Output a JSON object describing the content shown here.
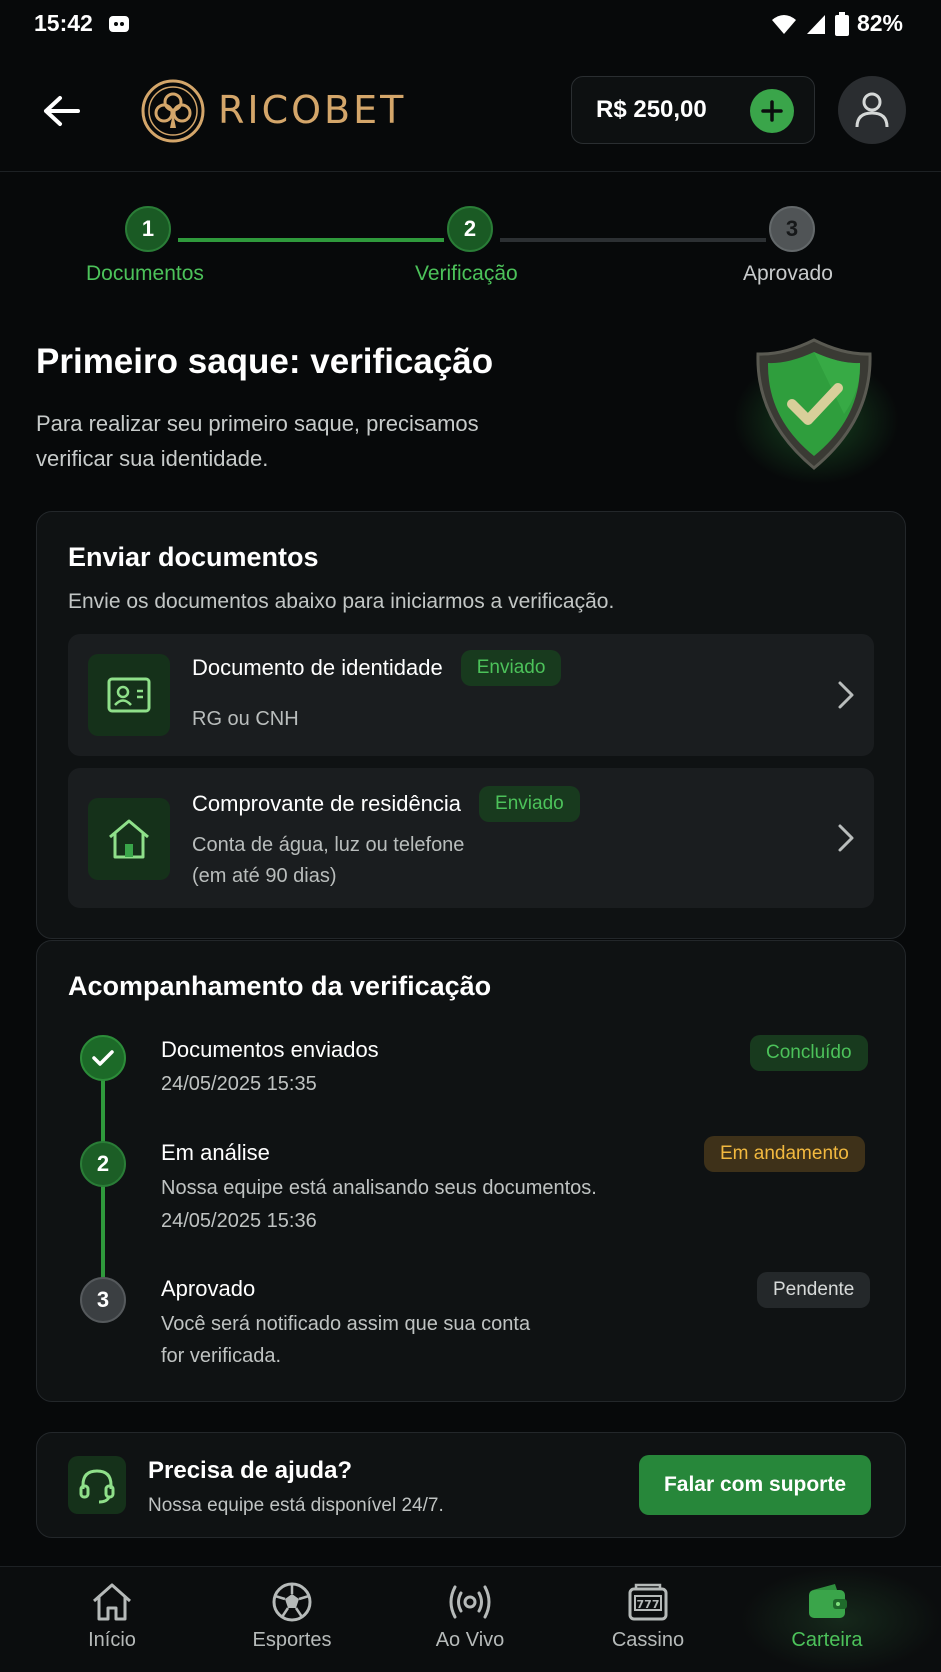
{
  "status_bar": {
    "time": "15:42",
    "battery": "82%"
  },
  "header": {
    "logo_text": "RICOBET",
    "balance": "R$ 250,00"
  },
  "stepper": {
    "steps": [
      {
        "num": "1",
        "label": "Documentos"
      },
      {
        "num": "2",
        "label": "Verificação"
      },
      {
        "num": "3",
        "label": "Aprovado"
      }
    ]
  },
  "intro": {
    "title": "Primeiro saque: verificação",
    "subtitle": "Para realizar seu primeiro saque, precisamos verificar sua identidade."
  },
  "documents": {
    "title": "Enviar documentos",
    "subtitle": "Envie os documentos abaixo para iniciarmos a verificação.",
    "items": [
      {
        "title": "Documento de identidade",
        "status": "Enviado",
        "sub1": "RG ou CNH",
        "sub2": ""
      },
      {
        "title": "Comprovante de residência",
        "status": "Enviado",
        "sub1": "Conta de água, luz ou telefone",
        "sub2": "(em até 90 dias)"
      }
    ]
  },
  "tracking": {
    "title": "Acompanhamento da verificação",
    "items": [
      {
        "marker": "✓",
        "title": "Documentos enviados",
        "line1": "24/05/2025 15:35",
        "line2": "",
        "status": "Concluído"
      },
      {
        "marker": "2",
        "title": "Em análise",
        "line1": "Nossa equipe está analisando seus documentos.",
        "line2": "24/05/2025 15:36",
        "status": "Em andamento"
      },
      {
        "marker": "3",
        "title": "Aprovado",
        "line1": "Você será notificado assim que sua conta",
        "line2": "for verificada.",
        "status": "Pendente"
      }
    ]
  },
  "help": {
    "title": "Precisa de ajuda?",
    "subtitle": "Nossa equipe está disponível 24/7.",
    "button": "Falar com suporte"
  },
  "nav": {
    "items": [
      {
        "label": "Início",
        "icon": "home-icon"
      },
      {
        "label": "Esportes",
        "icon": "soccer-ball-icon"
      },
      {
        "label": "Ao Vivo",
        "icon": "live-broadcast-icon"
      },
      {
        "label": "Cassino",
        "icon": "slot-machine-icon"
      },
      {
        "label": "Carteira",
        "icon": "wallet-icon"
      }
    ],
    "active": "Carteira"
  },
  "colors": {
    "accent": "#3aa54a",
    "brand_gold": "#d4a66a",
    "warning": "#f2b93f",
    "background": "#07090a"
  }
}
